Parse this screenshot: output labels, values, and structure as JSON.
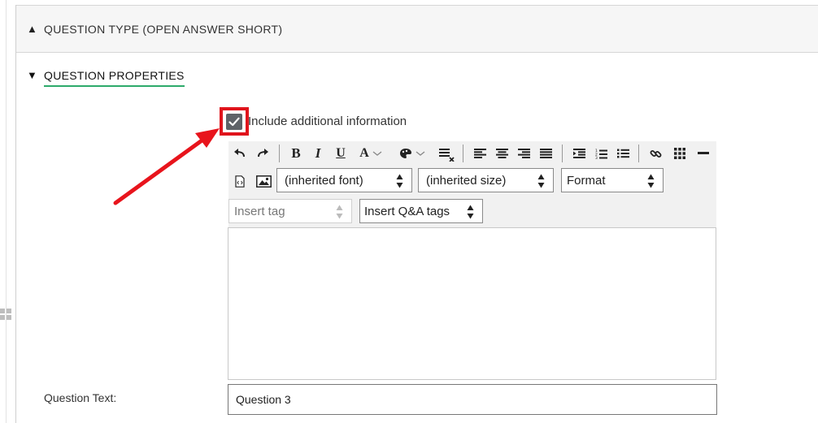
{
  "question_type": {
    "arrow": "▲",
    "label": "QUESTION TYPE (OPEN ANSWER SHORT)"
  },
  "question_properties": {
    "arrow": "▼",
    "label": "QUESTION PROPERTIES",
    "include_info": {
      "label": "Include additional information",
      "checked": true
    },
    "editor": {
      "font_select": "(inherited font)",
      "size_select": "(inherited size)",
      "format_select": "Format",
      "insert_tag": "Insert tag",
      "insert_qa_tags": "Insert Q&A tags",
      "icons": [
        "undo-icon",
        "redo-icon",
        "bold-icon",
        "italic-icon",
        "underline-icon",
        "font-color-icon",
        "background-color-icon",
        "clear-format-icon",
        "align-left-icon",
        "align-center-icon",
        "align-right-icon",
        "justify-icon",
        "indent-icon",
        "ordered-list-icon",
        "unordered-list-icon",
        "link-icon",
        "table-icon",
        "horizontal-rule-icon",
        "source-code-icon",
        "image-icon"
      ]
    },
    "question_text": {
      "label": "Question Text:",
      "value": "Question 3"
    }
  },
  "colors": {
    "highlight": "#e0141c",
    "underline_accent": "#2daa6b",
    "checkbox": "#5f6368"
  }
}
